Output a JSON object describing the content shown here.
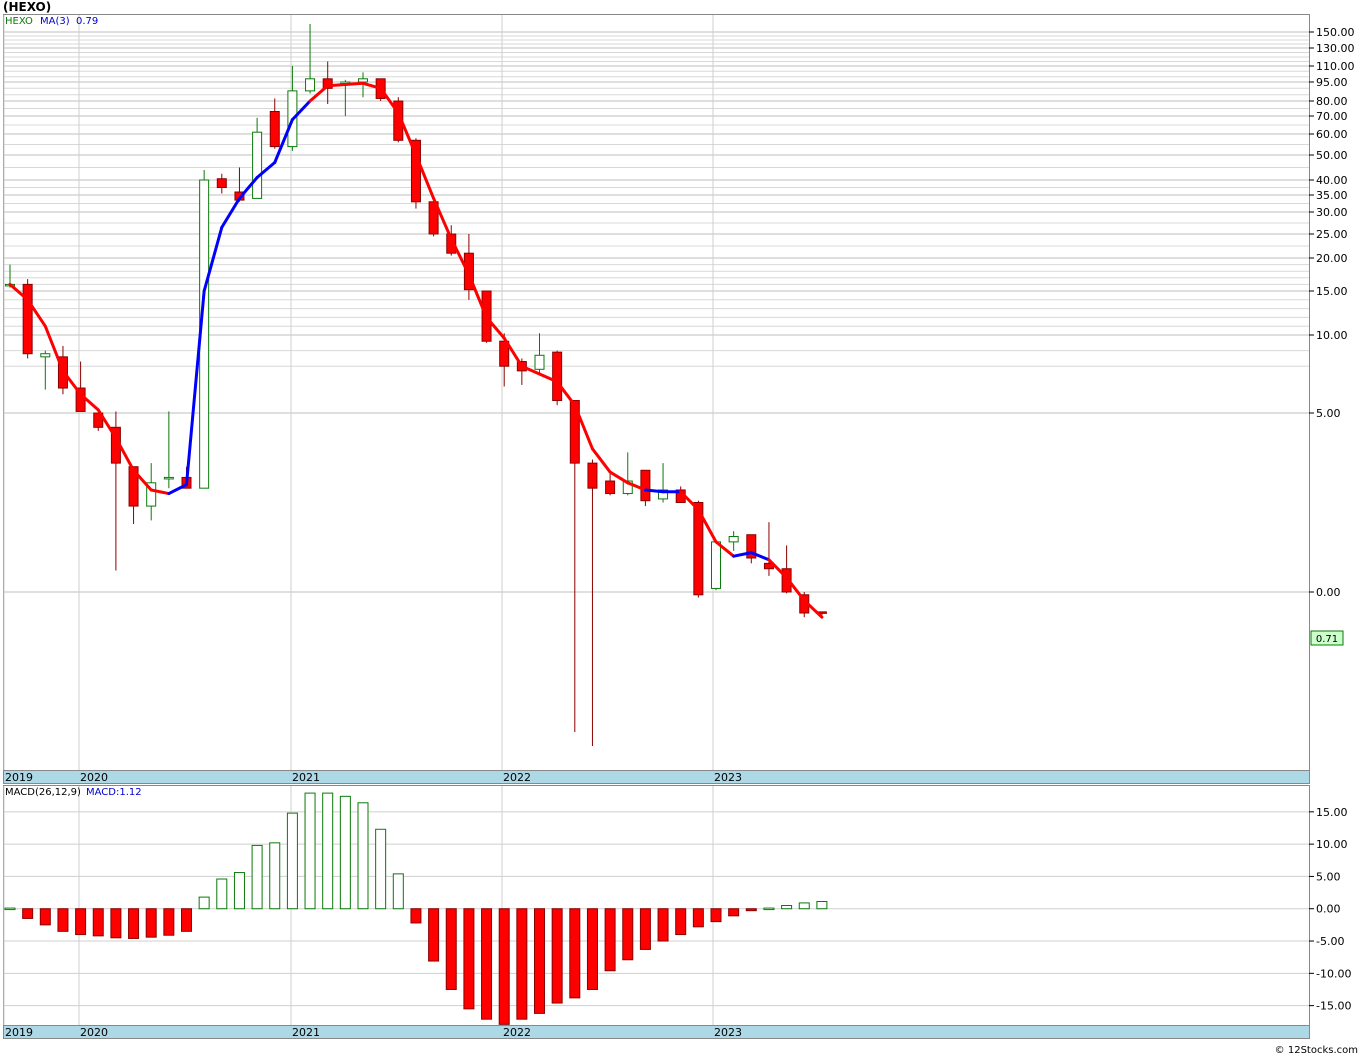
{
  "header": {
    "title": "(HEXO)"
  },
  "legend_price": {
    "symbol": "HEXO",
    "ma_label": "MA(3)",
    "ma_value": "0.79"
  },
  "legend_macd": {
    "label": "MACD(26,12,9)",
    "value_label": "MACD:1.12"
  },
  "last_price_label": "0.71",
  "footer": "© 12Stocks.com",
  "colors": {
    "up": "#0a7a0a",
    "down": "#ff0000",
    "down_wick": "#8b0000",
    "ma_up": "#0000ff",
    "ma_down": "#ff0000",
    "axis_band": "#add8e6",
    "price_tag_bg": "#ccffcc"
  },
  "chart_data": [
    {
      "type": "candlestick",
      "panel": "price",
      "scale": "non-linear (log-like, custom tick labels)",
      "y_ticks": [
        "150.00",
        "130.00",
        "110.00",
        "95.00",
        "80.00",
        "70.00",
        "60.00",
        "50.00",
        "40.00",
        "35.00",
        "30.00",
        "25.00",
        "20.00",
        "15.00",
        "10.00",
        "5.00",
        "0.00"
      ],
      "x_labels": [
        "2019",
        "2020",
        "2021",
        "2022",
        "2023"
      ],
      "candles": [
        {
          "o": 16.0,
          "h": 19.0,
          "l": 15.5,
          "c": 16.0
        },
        {
          "o": 16.0,
          "h": 16.8,
          "l": 8.5,
          "c": 8.8
        },
        {
          "o": 8.6,
          "h": 9.0,
          "l": 6.5,
          "c": 8.8
        },
        {
          "o": 8.6,
          "h": 9.3,
          "l": 6.2,
          "c": 6.6
        },
        {
          "o": 6.6,
          "h": 8.3,
          "l": 5.7,
          "c": 5.1
        },
        {
          "o": 5.0,
          "h": 5.0,
          "l": 4.5,
          "c": 4.6
        },
        {
          "o": 4.6,
          "h": 5.1,
          "l": 0.6,
          "c": 3.6
        },
        {
          "o": 3.5,
          "h": 3.5,
          "l": 1.9,
          "c": 2.4
        },
        {
          "o": 2.4,
          "h": 3.6,
          "l": 2.0,
          "c": 3.05
        },
        {
          "o": 3.2,
          "h": 5.1,
          "l": 2.9,
          "c": 3.2
        },
        {
          "o": 3.2,
          "h": 3.5,
          "l": 2.9,
          "c": 2.9
        },
        {
          "o": 2.9,
          "h": 44.0,
          "l": 2.9,
          "c": 40.0
        },
        {
          "o": 40.5,
          "h": 42.5,
          "l": 35.5,
          "c": 37.5
        },
        {
          "o": 36.0,
          "h": 45.0,
          "l": 33.0,
          "c": 33.5
        },
        {
          "o": 34.0,
          "h": 69.0,
          "l": 34.0,
          "c": 61.0
        },
        {
          "o": 73.0,
          "h": 82.0,
          "l": 53.0,
          "c": 54.0
        },
        {
          "o": 54.0,
          "h": 110.0,
          "l": 52.0,
          "c": 88.0
        },
        {
          "o": 88.0,
          "h": 160.0,
          "l": 86.0,
          "c": 98.0
        },
        {
          "o": 98.0,
          "h": 115.0,
          "l": 78.0,
          "c": 90.0
        },
        {
          "o": 95.0,
          "h": 97.0,
          "l": 70.0,
          "c": 95.0
        },
        {
          "o": 95.0,
          "h": 104.0,
          "l": 83.0,
          "c": 98.0
        },
        {
          "o": 98.0,
          "h": 98.0,
          "l": 80.0,
          "c": 82.0
        },
        {
          "o": 80.0,
          "h": 83.0,
          "l": 56.0,
          "c": 57.0
        },
        {
          "o": 57.0,
          "h": 58.0,
          "l": 31.0,
          "c": 33.0
        },
        {
          "o": 33.0,
          "h": 33.0,
          "l": 24.5,
          "c": 25.0
        },
        {
          "o": 25.0,
          "h": 27.0,
          "l": 20.5,
          "c": 21.0
        },
        {
          "o": 21.0,
          "h": 25.0,
          "l": 14.0,
          "c": 15.2
        },
        {
          "o": 15.0,
          "h": 15.0,
          "l": 9.5,
          "c": 9.6
        },
        {
          "o": 9.6,
          "h": 10.2,
          "l": 6.7,
          "c": 8.0
        },
        {
          "o": 8.3,
          "h": 8.5,
          "l": 6.8,
          "c": 7.7
        },
        {
          "o": 7.8,
          "h": 10.2,
          "l": 7.6,
          "c": 8.7
        },
        {
          "o": 8.9,
          "h": 9.0,
          "l": 5.5,
          "c": 5.8
        },
        {
          "o": 5.8,
          "h": 5.8,
          "l": -5.0,
          "c": 3.6
        },
        {
          "o": 3.6,
          "h": 3.7,
          "l": -5.5,
          "c": 2.9
        },
        {
          "o": 3.1,
          "h": 3.3,
          "l": 2.7,
          "c": 2.75
        },
        {
          "o": 2.75,
          "h": 3.9,
          "l": 2.7,
          "c": 3.1
        },
        {
          "o": 3.4,
          "h": 3.4,
          "l": 2.4,
          "c": 2.55
        },
        {
          "o": 2.6,
          "h": 3.6,
          "l": 2.5,
          "c": 2.85
        },
        {
          "o": 2.85,
          "h": 2.95,
          "l": 2.5,
          "c": 2.5
        },
        {
          "o": 2.5,
          "h": 2.55,
          "l": -0.2,
          "c": -0.1
        },
        {
          "o": 0.1,
          "h": 1.4,
          "l": 0.05,
          "c": 1.4
        },
        {
          "o": 1.4,
          "h": 1.7,
          "l": 1.15,
          "c": 1.55
        },
        {
          "o": 1.6,
          "h": 1.6,
          "l": 0.8,
          "c": 0.95
        },
        {
          "o": 0.8,
          "h": 1.95,
          "l": 0.45,
          "c": 0.65
        },
        {
          "o": 0.65,
          "h": 1.3,
          "l": -0.05,
          "c": 0.0
        },
        {
          "o": -0.1,
          "h": 0.0,
          "l": -0.9,
          "c": -0.75
        },
        {
          "o": -0.71,
          "h": -0.71,
          "l": -0.9,
          "c": -0.75
        }
      ],
      "ma3": [
        16.0,
        14.0,
        11.0,
        7.7,
        6.2,
        5.2,
        4.3,
        3.4,
        2.85,
        2.75,
        3.0,
        15.0,
        26.5,
        34.0,
        41.0,
        47.0,
        68.0,
        80.0,
        92.0,
        93.0,
        94.0,
        90.0,
        72.0,
        50.0,
        34.0,
        24.0,
        17.5,
        12.0,
        9.8,
        8.0,
        7.5,
        7.0,
        5.5,
        4.0,
        3.35,
        3.05,
        2.85,
        2.8,
        2.8,
        2.3,
        1.4,
        1.0,
        1.1,
        0.9,
        0.4,
        -0.3,
        -0.9
      ],
      "ma3_up_segments": [
        [
          9,
          13
        ],
        [
          13,
          17
        ],
        [
          36,
          38
        ],
        [
          41,
          43
        ]
      ]
    },
    {
      "type": "bar",
      "panel": "macd",
      "title": "MACD(26,12,9)",
      "y_ticks": [
        "15.00",
        "10.00",
        "5.00",
        "0.00",
        "-5.00",
        "-10.00",
        "-15.00"
      ],
      "ylim": [
        -18,
        19
      ],
      "x_labels": [
        "2019",
        "2020",
        "2021",
        "2022",
        "2023"
      ],
      "values": [
        0.1,
        -1.5,
        -2.5,
        -3.5,
        -4.0,
        -4.2,
        -4.5,
        -4.6,
        -4.4,
        -4.1,
        -3.5,
        1.8,
        4.6,
        5.6,
        9.8,
        10.2,
        14.8,
        17.9,
        17.9,
        17.4,
        16.4,
        12.3,
        5.4,
        -2.2,
        -8.1,
        -12.5,
        -15.5,
        -17.1,
        -17.9,
        -17.1,
        -16.2,
        -14.6,
        -13.8,
        -12.5,
        -9.6,
        -7.9,
        -6.3,
        -5.0,
        -4.0,
        -2.8,
        -2.0,
        -1.1,
        -0.3,
        0.1,
        0.5,
        0.9,
        1.12
      ]
    }
  ]
}
